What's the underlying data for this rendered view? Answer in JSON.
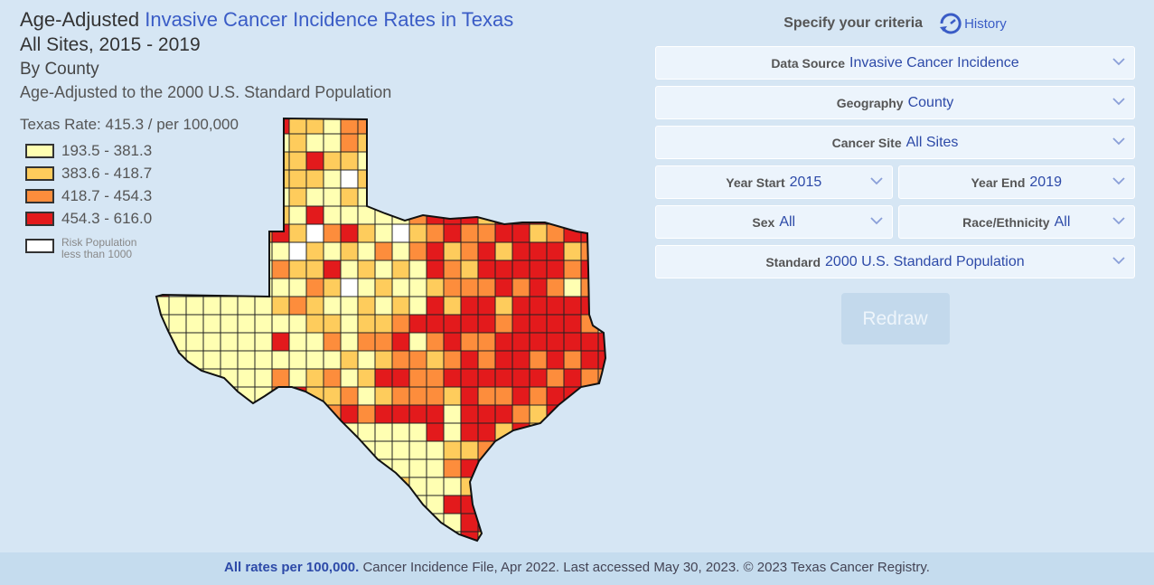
{
  "title": {
    "prefix": "Age-Adjusted",
    "highlight": "Invasive Cancer Incidence Rates in Texas",
    "line2": "All Sites, 2015 - 2019",
    "line3": "By County",
    "line4": "Age-Adjusted to the 2000 U.S. Standard Population"
  },
  "legend": {
    "state_rate": "Texas Rate: 415.3 / per 100,000",
    "classes": [
      {
        "label": "193.5 - 381.3",
        "color": "#ffffb2"
      },
      {
        "label": "383.6 - 418.7",
        "color": "#fecc5c"
      },
      {
        "label": "418.7 - 454.3",
        "color": "#fd8d3c"
      },
      {
        "label": "454.3 - 616.0",
        "color": "#e31a1c"
      }
    ],
    "suppressed": {
      "label_line1": "Risk Population",
      "label_line2": "less than 1000",
      "color": "#ffffff"
    }
  },
  "criteria": {
    "heading": "Specify your criteria",
    "history_label": "History",
    "fields": {
      "data_source": {
        "label": "Data Source",
        "value": "Invasive Cancer Incidence"
      },
      "geography": {
        "label": "Geography",
        "value": "County"
      },
      "cancer_site": {
        "label": "Cancer Site",
        "value": "All Sites"
      },
      "year_start": {
        "label": "Year Start",
        "value": "2015"
      },
      "year_end": {
        "label": "Year End",
        "value": "2019"
      },
      "sex": {
        "label": "Sex",
        "value": "All"
      },
      "race": {
        "label": "Race/Ethnicity",
        "value": "All"
      },
      "standard": {
        "label": "Standard",
        "value": "2000 U.S. Standard Population"
      }
    },
    "redraw_label": "Redraw"
  },
  "footer": {
    "bold": "All rates per 100,000.",
    "text": " Cancer Incidence File, Apr 2022. Last accessed May 30, 2023. © 2023 Texas Cancer Registry."
  },
  "colors": {
    "accent": "#3a5cc6",
    "background": "#d6e6f4"
  }
}
